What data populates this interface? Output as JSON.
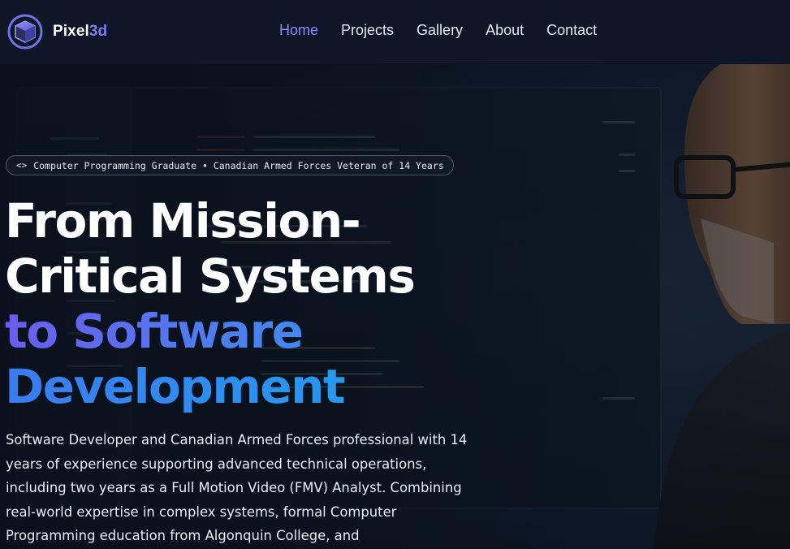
{
  "brand": {
    "name_main": "Pixel",
    "name_accent": "3d",
    "logo_icon": "cube-logo-icon"
  },
  "nav": {
    "items": [
      {
        "label": "Home",
        "active": true
      },
      {
        "label": "Projects",
        "active": false
      },
      {
        "label": "Gallery",
        "active": false
      },
      {
        "label": "About",
        "active": false
      },
      {
        "label": "Contact",
        "active": false
      }
    ]
  },
  "hero": {
    "badge": {
      "icon": "<>",
      "text": "Computer Programming Graduate • Canadian Armed Forces Veteran of 14 Years"
    },
    "headline": {
      "line1": "From Mission-",
      "line2": "Critical Systems",
      "line3": "to Software",
      "line4": "Development"
    },
    "intro": "Software Developer and Canadian Armed Forces professional with 14 years of experience supporting advanced technical operations, including two years as a Full Motion Video (FMV) Analyst. Combining real-world expertise in complex systems, formal Computer Programming education from Algonquin College, and"
  },
  "colors": {
    "header_bg": "#0e1627",
    "nav_active": "#8a8df2",
    "gradient_start": "#6b5cf0",
    "gradient_end": "#1ea3f0"
  }
}
